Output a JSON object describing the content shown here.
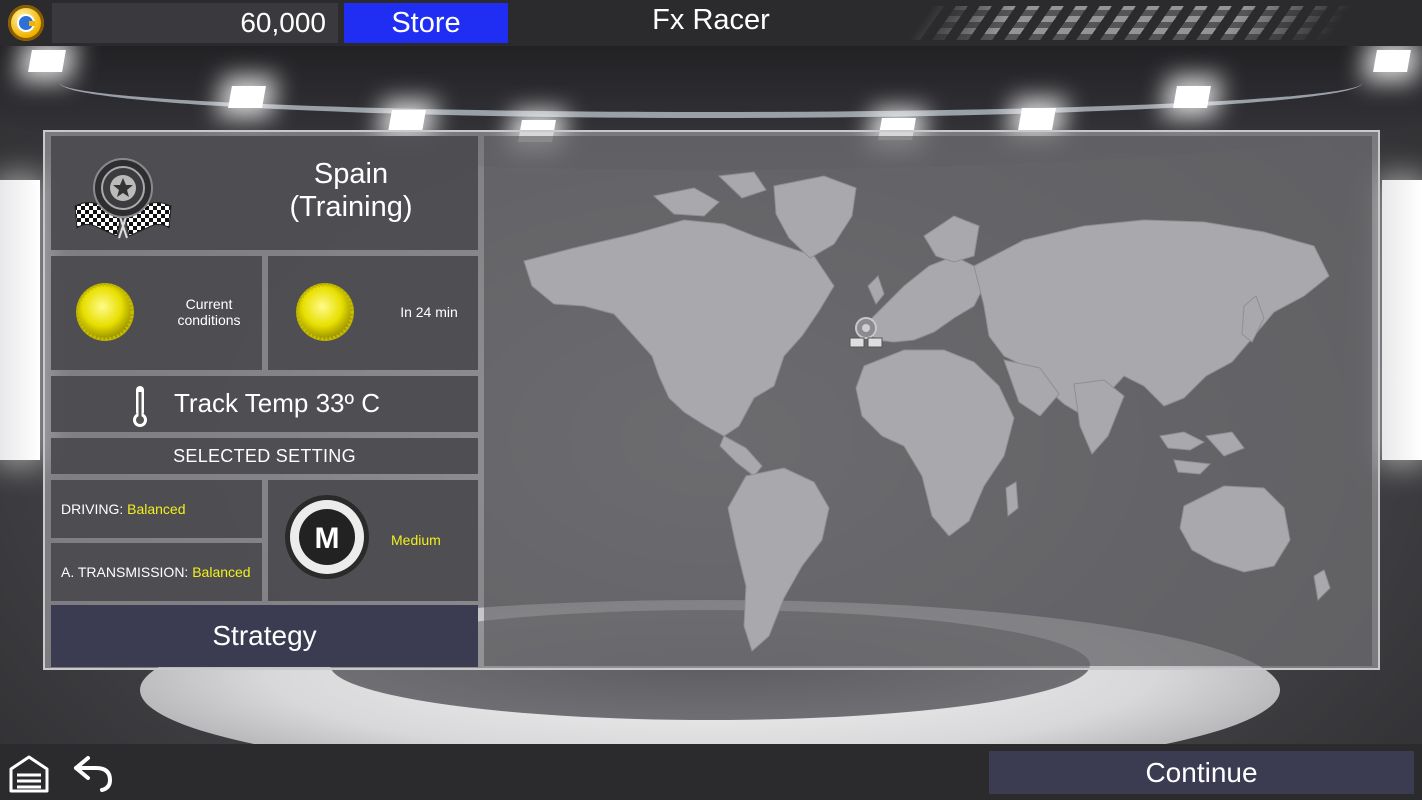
{
  "top_bar": {
    "currency_amount": "60,000",
    "store_label": "Store",
    "title": "Fx Racer"
  },
  "race": {
    "track_line1": "Spain",
    "track_line2": "(Training)",
    "current_conditions_label_1": "Current",
    "current_conditions_label_2": "conditions",
    "forecast_label": "In 24 min",
    "track_temp": "Track Temp 33º C"
  },
  "settings": {
    "header": "SELECTED SETTING",
    "driving_label": "DRIVING:",
    "driving_value": "Balanced",
    "transmission_label": "A. TRANSMISSION:",
    "transmission_value": "Balanced",
    "tyre_letter": "M",
    "tyre_value": "Medium",
    "strategy_label": "Strategy"
  },
  "bottom_bar": {
    "continue_label": "Continue"
  },
  "colors": {
    "store": "#1f2ef2",
    "highlight_text": "#f1ef1d",
    "button_dark": "#3b3b52"
  },
  "icons": {
    "coin": "coin-icon",
    "track": "checkered-flags-icon",
    "weather_now": "sun-icon",
    "weather_forecast": "sun-icon",
    "temperature": "thermometer-icon",
    "tyre": "tyre-medium-icon",
    "home": "garage-home-icon",
    "back": "back-arrow-icon"
  }
}
